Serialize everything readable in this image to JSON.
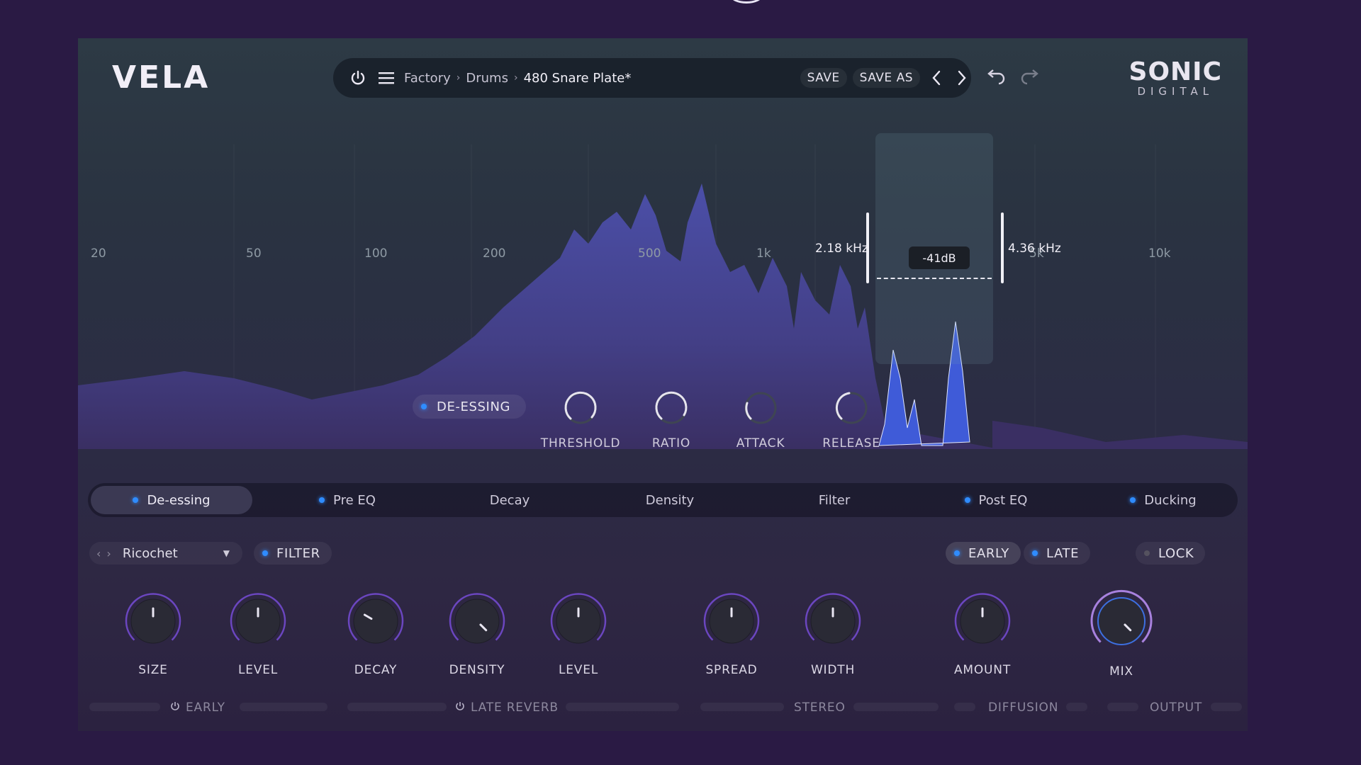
{
  "app": {
    "logo": "VELA",
    "brand_main": "SONIC",
    "brand_sub": "DIGITAL"
  },
  "topbar": {
    "breadcrumb": [
      "Factory",
      "Drums",
      "480 Snare Plate*"
    ],
    "save_label": "SAVE",
    "save_as_label": "SAVE AS",
    "power_icon": "power-icon",
    "menu_icon": "hamburger-menu-icon",
    "prev_icon": "chevron-left-icon",
    "next_icon": "chevron-right-icon",
    "undo_icon": "undo-icon",
    "redo_icon": "redo-icon"
  },
  "spectrum": {
    "freq_labels": [
      "20",
      "50",
      "100",
      "200",
      "500",
      "1k",
      "5k",
      "10k"
    ],
    "band_low": "2.18 kHz",
    "band_high": "4.36 kHz",
    "band_gain": "-41dB"
  },
  "deessing": {
    "toggle_label": "DE-ESSING",
    "toggle_on": true,
    "knobs": [
      "THRESHOLD",
      "RATIO",
      "ATTACK",
      "RELEASE"
    ]
  },
  "tabs": [
    {
      "label": "De-essing",
      "dot": true,
      "active": true
    },
    {
      "label": "Pre EQ",
      "dot": true,
      "active": false
    },
    {
      "label": "Decay",
      "dot": false,
      "active": false
    },
    {
      "label": "Density",
      "dot": false,
      "active": false
    },
    {
      "label": "Filter",
      "dot": false,
      "active": false
    },
    {
      "label": "Post EQ",
      "dot": true,
      "active": false
    },
    {
      "label": "Ducking",
      "dot": true,
      "active": false
    }
  ],
  "controls": {
    "preset_name": "Ricochet",
    "filter_label": "FILTER",
    "early_label": "EARLY",
    "late_label": "LATE",
    "lock_label": "LOCK"
  },
  "knobs": [
    "SIZE",
    "LEVEL",
    "DECAY",
    "DENSITY",
    "LEVEL",
    "SPREAD",
    "WIDTH",
    "AMOUNT",
    "MIX"
  ],
  "sections": [
    "EARLY",
    "LATE REVERB",
    "STEREO",
    "DIFFUSION",
    "OUTPUT"
  ],
  "colors": {
    "accent": "#2f8cff",
    "knob_arc": "#7a4fe0",
    "background": "#2a1a44"
  }
}
